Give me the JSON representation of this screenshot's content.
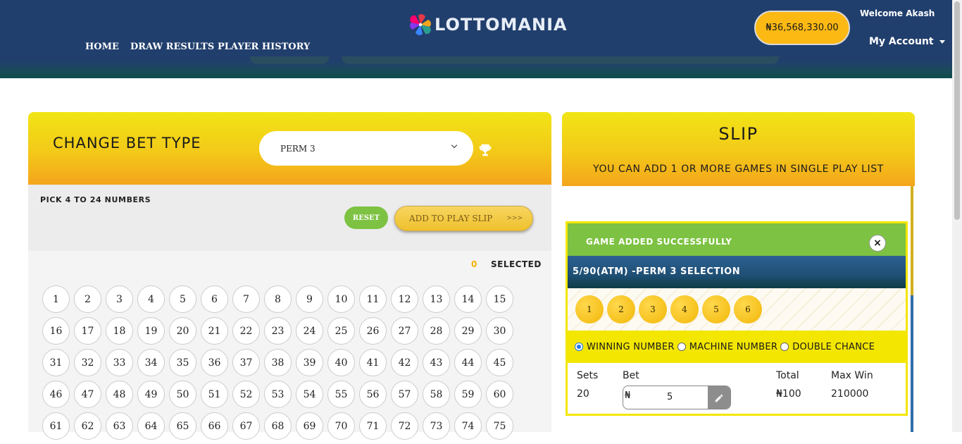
{
  "brand": {
    "name": "LOTTOMANIA"
  },
  "nav": [
    "HOME",
    "DRAW RESULTS",
    "PLAYER HISTORY"
  ],
  "account": {
    "balance": "₦36,568,330.00",
    "welcome": "Welcome Akash",
    "menu": "My Account"
  },
  "betpanel": {
    "title": "CHANGE BET TYPE",
    "bet_type": "PERM 3",
    "pick_label": "PICK 4 TO 24 NUMBERS",
    "reset": "RESET",
    "add": "ADD TO PLAY SLIP",
    "arrows": ">>>",
    "selected_count": "0",
    "selected_label": "SELECTED",
    "numbers": [
      "1",
      "2",
      "3",
      "4",
      "5",
      "6",
      "7",
      "8",
      "9",
      "10",
      "11",
      "12",
      "13",
      "14",
      "15",
      "16",
      "17",
      "18",
      "19",
      "20",
      "21",
      "22",
      "23",
      "24",
      "25",
      "26",
      "27",
      "28",
      "29",
      "30",
      "31",
      "32",
      "33",
      "34",
      "35",
      "36",
      "37",
      "38",
      "39",
      "40",
      "41",
      "42",
      "43",
      "44",
      "45",
      "46",
      "47",
      "48",
      "49",
      "50",
      "51",
      "52",
      "53",
      "54",
      "55",
      "56",
      "57",
      "58",
      "59",
      "60",
      "61",
      "62",
      "63",
      "64",
      "65",
      "66",
      "67",
      "68",
      "69",
      "70",
      "71",
      "72",
      "73",
      "74",
      "75"
    ]
  },
  "slip": {
    "title": "SLIP",
    "subtitle": "YOU CAN ADD 1 OR MORE GAMES IN SINGLE PLAY LIST",
    "success": "GAME ADDED SUCCESSFULLY",
    "close": "×",
    "game_title": "5/90(ATM) -PERM 3 SELECTION",
    "balls": [
      "1",
      "2",
      "3",
      "4",
      "5",
      "6"
    ],
    "options": [
      {
        "label": "WINNING NUMBER",
        "checked": true
      },
      {
        "label": "MACHINE NUMBER",
        "checked": false
      },
      {
        "label": "DOUBLE CHANCE",
        "checked": false
      }
    ],
    "sets_label": "Sets",
    "sets_value": "20",
    "bet_label": "Bet",
    "bet_currency": "₦",
    "bet_value": "5",
    "total_label": "Total",
    "total_value": "₦100",
    "maxwin_label": "Max Win",
    "maxwin_value": "210000"
  }
}
